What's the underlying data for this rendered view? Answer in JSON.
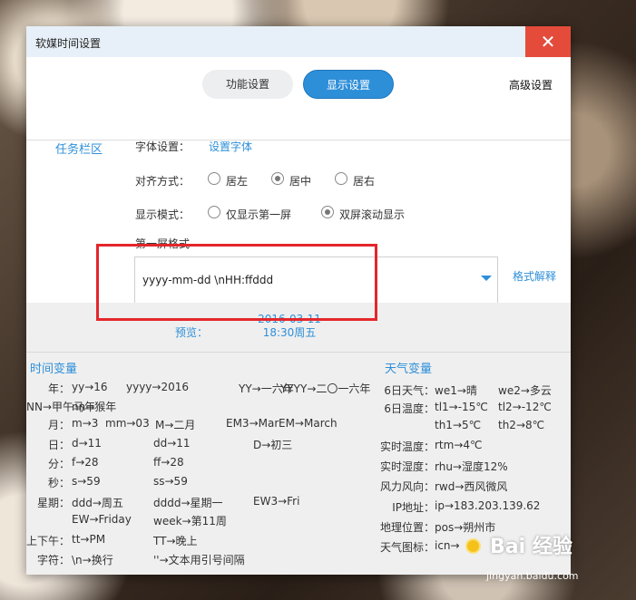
{
  "window": {
    "title": "软媒时间设置",
    "close": "✕"
  },
  "tabs": {
    "function": "功能设置",
    "display": "显示设置",
    "advanced": "高级设置"
  },
  "side": {
    "taskbar": "任务栏区"
  },
  "font": {
    "label": "字体设置：",
    "link": "设置字体"
  },
  "align": {
    "label": "对齐方式：",
    "options": [
      "居左",
      "居中",
      "居右"
    ],
    "selected": 1
  },
  "mode": {
    "label": "显示模式：",
    "options": [
      "仅显示第一屏",
      "双屏滚动显示"
    ],
    "selected": 1
  },
  "format": {
    "label": "第一屏格式",
    "value": "yyyy-mm-dd \\nHH:ffddd",
    "help": "格式解释"
  },
  "preview": {
    "label": "预览：",
    "line1": "2016-03-11",
    "line2": "18:30周五"
  },
  "time_vars": {
    "title": "时间变量",
    "rows": [
      {
        "k": "年：",
        "items": [
          "yy→16",
          "yyyy→2016",
          "YY→一六年",
          "YYYY→二〇一六年"
        ]
      },
      {
        "k": "",
        "items": [
          "nn→猴年",
          "NN→甲午马年"
        ]
      },
      {
        "k": "月：",
        "items": [
          "m→3",
          "mm→03",
          "M→二月",
          "EM3→Mar",
          "EM→March"
        ]
      },
      {
        "k": "日：",
        "items": [
          "d→11",
          "dd→11",
          "D→初三"
        ]
      },
      {
        "k": "分：",
        "items": [
          "f→28",
          "ff→28"
        ]
      },
      {
        "k": "秒：",
        "items": [
          "s→59",
          "ss→59"
        ]
      },
      {
        "k": "星期：",
        "items": [
          "ddd→周五",
          "dddd→星期一",
          "EW3→Fri"
        ]
      },
      {
        "k": "",
        "items": [
          "EW→Friday",
          "week→第11周"
        ]
      },
      {
        "k": "上下午：",
        "items": [
          "tt→PM",
          "TT→晚上"
        ]
      },
      {
        "k": "字符：",
        "items": [
          "\\n→换行",
          "''→文本用引号间隔"
        ]
      }
    ]
  },
  "weather_vars": {
    "title": "天气变量",
    "rows": [
      {
        "k": "6日天气：",
        "items": [
          "we1→晴",
          "we2→多云"
        ]
      },
      {
        "k": "6日温度：",
        "items": [
          "tl1→-15℃",
          "tl2→-12℃"
        ]
      },
      {
        "k": "",
        "items": [
          "th1→5℃",
          "th2→8℃"
        ]
      },
      {
        "k": "实时温度：",
        "items": [
          "rtm→4℃"
        ]
      },
      {
        "k": "实时湿度：",
        "items": [
          "rhu→湿度12%"
        ]
      },
      {
        "k": "风力风向：",
        "items": [
          "rwd→西风微风"
        ]
      },
      {
        "k": "IP地址：",
        "items": [
          "ip→183.203.139.62"
        ]
      },
      {
        "k": "地理位置：",
        "items": [
          "pos→朔州市"
        ]
      },
      {
        "k": "天气图标：",
        "items": [
          "icn→"
        ]
      }
    ]
  },
  "watermark": {
    "brand": "Bai 经验",
    "url": "jingyan.baidu.com"
  }
}
